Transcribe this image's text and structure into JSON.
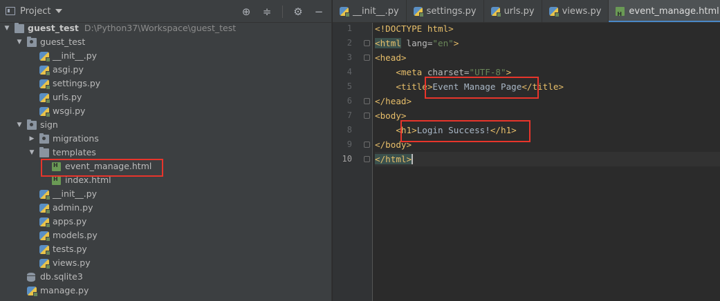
{
  "project_panel": {
    "title": "Project",
    "tools": [
      "crosshair-icon",
      "collapse-icon",
      "gear-icon",
      "hide-icon"
    ],
    "tree": [
      {
        "label": "guest_test",
        "path": "D:\\Python37\\Workspace\\guest_test",
        "icon": "folder",
        "level": 0,
        "expanded": true,
        "bold": true
      },
      {
        "label": "guest_test",
        "icon": "package",
        "level": 1,
        "expanded": true
      },
      {
        "label": "__init__.py",
        "icon": "python",
        "level": 2
      },
      {
        "label": "asgi.py",
        "icon": "python",
        "level": 2
      },
      {
        "label": "settings.py",
        "icon": "python",
        "level": 2
      },
      {
        "label": "urls.py",
        "icon": "python",
        "level": 2
      },
      {
        "label": "wsgi.py",
        "icon": "python",
        "level": 2
      },
      {
        "label": "sign",
        "icon": "package",
        "level": 1,
        "expanded": true
      },
      {
        "label": "migrations",
        "icon": "package",
        "level": 2,
        "expanded": false
      },
      {
        "label": "templates",
        "icon": "folder",
        "level": 2,
        "expanded": true
      },
      {
        "label": "event_manage.html",
        "icon": "html",
        "level": 3
      },
      {
        "label": "index.html",
        "icon": "html",
        "level": 3
      },
      {
        "label": "__init__.py",
        "icon": "python",
        "level": 2
      },
      {
        "label": "admin.py",
        "icon": "python",
        "level": 2
      },
      {
        "label": "apps.py",
        "icon": "python",
        "level": 2
      },
      {
        "label": "models.py",
        "icon": "python",
        "level": 2
      },
      {
        "label": "tests.py",
        "icon": "python",
        "level": 2
      },
      {
        "label": "views.py",
        "icon": "python",
        "level": 2
      },
      {
        "label": "db.sqlite3",
        "icon": "database",
        "level": 1
      },
      {
        "label": "manage.py",
        "icon": "python",
        "level": 1
      }
    ]
  },
  "tabs": [
    {
      "label": "__init__.py",
      "icon": "python"
    },
    {
      "label": "settings.py",
      "icon": "python"
    },
    {
      "label": "urls.py",
      "icon": "python"
    },
    {
      "label": "views.py",
      "icon": "python"
    },
    {
      "label": "event_manage.html",
      "icon": "html",
      "active": true
    }
  ],
  "editor": {
    "current_line": 10,
    "lines": [
      {
        "n": "1",
        "parts": [
          {
            "c": "dt",
            "t": "<!DOCTYPE html>"
          }
        ]
      },
      {
        "n": "2",
        "parts": [
          {
            "c": "tg hl-tag",
            "t": "<html"
          },
          {
            "c": "at",
            "t": " lang="
          },
          {
            "c": "av",
            "t": "\"en\""
          },
          {
            "c": "tg",
            "t": ">"
          }
        ]
      },
      {
        "n": "3",
        "parts": [
          {
            "c": "tg",
            "t": "<head>"
          }
        ]
      },
      {
        "n": "4",
        "parts": [
          {
            "c": "tx",
            "t": "    "
          },
          {
            "c": "tg",
            "t": "<meta"
          },
          {
            "c": "at",
            "t": " charset="
          },
          {
            "c": "av",
            "t": "\"UTF-8\""
          },
          {
            "c": "tg",
            "t": ">"
          }
        ]
      },
      {
        "n": "5",
        "parts": [
          {
            "c": "tx",
            "t": "    "
          },
          {
            "c": "tg",
            "t": "<title>"
          },
          {
            "c": "tx",
            "t": "Event Manage Page"
          },
          {
            "c": "tg",
            "t": "</title>"
          }
        ]
      },
      {
        "n": "6",
        "parts": [
          {
            "c": "tg",
            "t": "</head>"
          }
        ]
      },
      {
        "n": "7",
        "parts": [
          {
            "c": "tg",
            "t": "<body>"
          }
        ]
      },
      {
        "n": "8",
        "parts": [
          {
            "c": "tx",
            "t": "    "
          },
          {
            "c": "tg",
            "t": "<h1>"
          },
          {
            "c": "tx",
            "t": "Login Success!"
          },
          {
            "c": "tg",
            "t": "</h1>"
          }
        ]
      },
      {
        "n": "9",
        "parts": [
          {
            "c": "tg",
            "t": "</body>"
          }
        ]
      },
      {
        "n": "10",
        "parts": [
          {
            "c": "tg hl-tag",
            "t": "</html>"
          }
        ],
        "caret": true
      }
    ]
  },
  "colors": {
    "annotation": "#e8352b",
    "tag": "#e8bf6a",
    "attr_value": "#6a8759",
    "active_tab_underline": "#4a88c7"
  }
}
